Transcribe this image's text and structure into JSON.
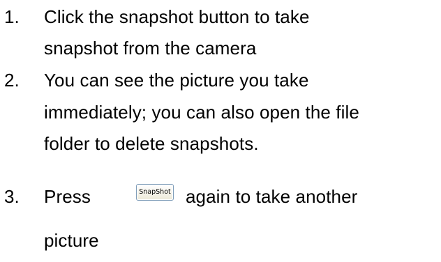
{
  "steps": [
    {
      "number": "1.",
      "lines": [
        "Click the snapshot button to take",
        "snapshot from the camera"
      ]
    },
    {
      "number": "2.",
      "lines": [
        "You can see the picture you take",
        "immediately; you can also open the file",
        "folder to delete snapshots."
      ]
    },
    {
      "number": "3.",
      "before_button": "Press",
      "button_label": "SnapShot",
      "after_button": "again to take another",
      "continuation": "picture"
    }
  ]
}
